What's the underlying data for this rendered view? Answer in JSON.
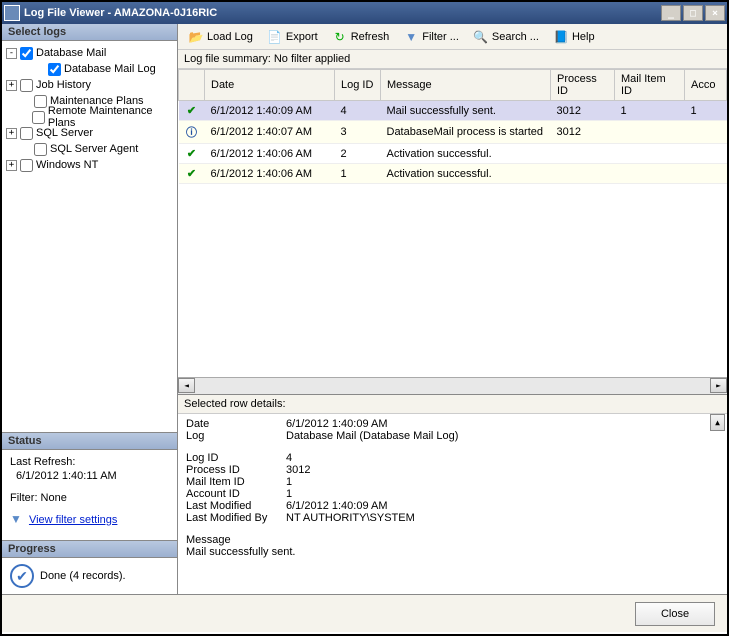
{
  "window": {
    "title": "Log File Viewer - AMAZONA-0J16RIC"
  },
  "left": {
    "select_header": "Select logs",
    "tree": [
      {
        "indent": 0,
        "toggle": "-",
        "checked": true,
        "label": "Database Mail"
      },
      {
        "indent": 2,
        "toggle": "",
        "checked": true,
        "label": "Database Mail Log"
      },
      {
        "indent": 0,
        "toggle": "+",
        "checked": false,
        "label": "Job History"
      },
      {
        "indent": 1,
        "toggle": "",
        "checked": false,
        "label": "Maintenance Plans"
      },
      {
        "indent": 1,
        "toggle": "",
        "checked": false,
        "label": "Remote Maintenance Plans"
      },
      {
        "indent": 0,
        "toggle": "+",
        "checked": false,
        "label": "SQL Server"
      },
      {
        "indent": 1,
        "toggle": "",
        "checked": false,
        "label": "SQL Server Agent"
      },
      {
        "indent": 0,
        "toggle": "+",
        "checked": false,
        "label": "Windows NT"
      }
    ],
    "status_header": "Status",
    "status": {
      "last_refresh_label": "Last Refresh:",
      "last_refresh_value": "6/1/2012 1:40:11 AM",
      "filter_label": "Filter: None",
      "filter_link": "View filter settings"
    },
    "progress_header": "Progress",
    "progress_text": "Done (4 records)."
  },
  "toolbar": {
    "load": "Load Log",
    "export": "Export",
    "refresh": "Refresh",
    "filter": "Filter ...",
    "search": "Search ...",
    "help": "Help"
  },
  "summary": "Log file summary: No filter applied",
  "columns": {
    "date": "Date",
    "logid": "Log ID",
    "message": "Message",
    "procid": "Process ID",
    "mailid": "Mail Item ID",
    "accid": "Acco"
  },
  "rows": [
    {
      "status": "check",
      "date": "6/1/2012 1:40:09 AM",
      "logid": "4",
      "message": "Mail successfully sent.",
      "procid": "3012",
      "mailid": "1",
      "accid": "1",
      "selected": true
    },
    {
      "status": "info",
      "date": "6/1/2012 1:40:07 AM",
      "logid": "3",
      "message": "DatabaseMail process is started",
      "procid": "3012",
      "mailid": "",
      "accid": ""
    },
    {
      "status": "check",
      "date": "6/1/2012 1:40:06 AM",
      "logid": "2",
      "message": "Activation successful.",
      "procid": "",
      "mailid": "",
      "accid": ""
    },
    {
      "status": "check",
      "date": "6/1/2012 1:40:06 AM",
      "logid": "1",
      "message": "Activation successful.",
      "procid": "",
      "mailid": "",
      "accid": ""
    }
  ],
  "details_header": "Selected row details:",
  "details": {
    "date_l": "Date",
    "date_v": "6/1/2012 1:40:09 AM",
    "log_l": "Log",
    "log_v": "Database Mail (Database Mail Log)",
    "logid_l": "Log ID",
    "logid_v": "4",
    "procid_l": "Process ID",
    "procid_v": "3012",
    "mailid_l": "Mail Item ID",
    "mailid_v": "1",
    "accid_l": "Account ID",
    "accid_v": "1",
    "mod_l": "Last Modified",
    "mod_v": "6/1/2012 1:40:09 AM",
    "modby_l": "Last Modified By",
    "modby_v": "NT AUTHORITY\\SYSTEM",
    "msg_l": "Message",
    "msg_v": "Mail successfully sent."
  },
  "footer": {
    "close": "Close"
  }
}
